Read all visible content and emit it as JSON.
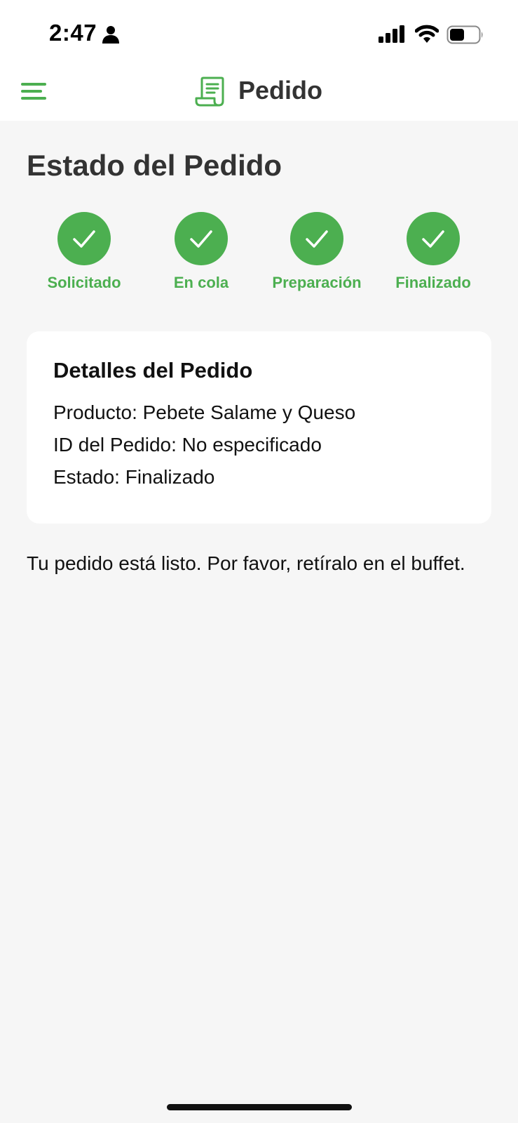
{
  "status_bar": {
    "time": "2:47",
    "icons": [
      "person-icon",
      "cellular-signal-icon",
      "wifi-icon",
      "battery-icon"
    ]
  },
  "header": {
    "title": "Pedido",
    "menu_icon": "hamburger-menu-icon",
    "title_icon": "receipt-icon"
  },
  "page": {
    "title": "Estado del Pedido"
  },
  "steps": [
    {
      "label": "Solicitado",
      "completed": true
    },
    {
      "label": "En cola",
      "completed": true
    },
    {
      "label": "Preparación",
      "completed": true
    },
    {
      "label": "Finalizado",
      "completed": true
    }
  ],
  "details": {
    "title": "Detalles del Pedido",
    "product": "Producto: Pebete Salame y Queso",
    "order_id": "ID del Pedido: No especificado",
    "status": "Estado: Finalizado"
  },
  "message": "Tu pedido está listo. Por favor, retíralo en el buffet.",
  "colors": {
    "accent": "#4caf50",
    "background": "#f6f6f6",
    "card": "#ffffff",
    "title_text": "#333333"
  }
}
